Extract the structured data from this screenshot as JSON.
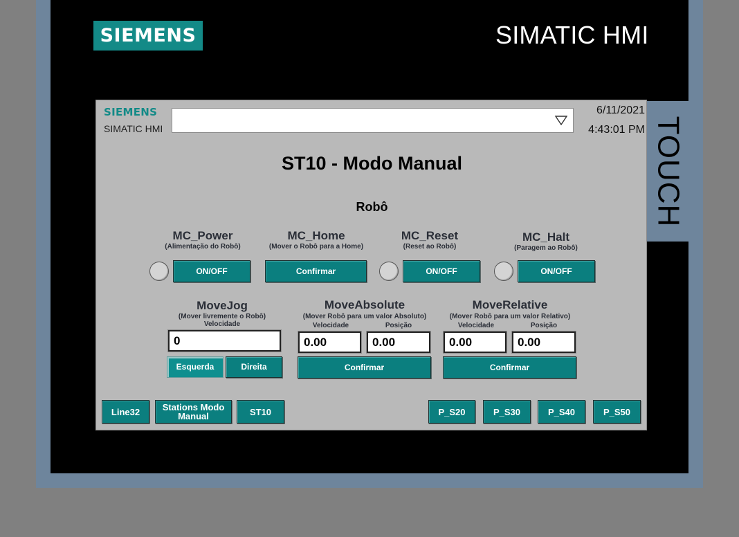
{
  "bezel": {
    "brand": "SIEMENS",
    "title": "SIMATIC HMI",
    "touch_label": "TOUCH"
  },
  "header": {
    "logo": "SIEMENS",
    "subtitle": "SIMATIC HMI",
    "screen_select": {
      "value": ""
    },
    "date": "6/11/2021",
    "time": "4:43:01 PM"
  },
  "page": {
    "title": "ST10 - Modo Manual",
    "section": "Robô"
  },
  "functions": [
    {
      "title": "MC_Power",
      "subtitle": "(Alimentação do Robô)",
      "button": "ON/OFF",
      "has_lamp": true
    },
    {
      "title": "MC_Home",
      "subtitle": "(Mover o Robô para a Home)",
      "button": "Confirmar",
      "has_lamp": false
    },
    {
      "title": "MC_Reset",
      "subtitle": "(Reset ao Robô)",
      "button": "ON/OFF",
      "has_lamp": true
    },
    {
      "title": "MC_Halt",
      "subtitle": "(Paragem ao Robô)",
      "button": "ON/OFF",
      "has_lamp": true
    }
  ],
  "movejog": {
    "title": "MoveJog",
    "subtitle": "(Mover livremente o Robô)",
    "velocity_label": "Velocidade",
    "velocity_value": "0",
    "left_button": "Esquerda",
    "right_button": "Direita"
  },
  "moveabsolute": {
    "title": "MoveAbsolute",
    "subtitle": "(Mover Robô para um valor Absoluto)",
    "velocity_label": "Velocidade",
    "position_label": "Posição",
    "velocity_value": "0.00",
    "position_value": "0.00",
    "confirm_button": "Confirmar"
  },
  "moverelative": {
    "title": "MoveRelative",
    "subtitle": "(Mover Robô para um valor Relativo)",
    "velocity_label": "Velocidade",
    "position_label": "Posição",
    "velocity_value": "0.00",
    "position_value": "0.00",
    "confirm_button": "Confirmar"
  },
  "nav": {
    "left": [
      "Line32",
      "Stations Modo Manual",
      "ST10"
    ],
    "right": [
      "P_S20",
      "P_S30",
      "P_S40",
      "P_S50"
    ]
  },
  "colors": {
    "button": "#0b7f7f",
    "brand_teal": "#138a87",
    "screen_bg": "#b9b9b9",
    "bezel": "#000000",
    "frame": "#6e859c"
  }
}
